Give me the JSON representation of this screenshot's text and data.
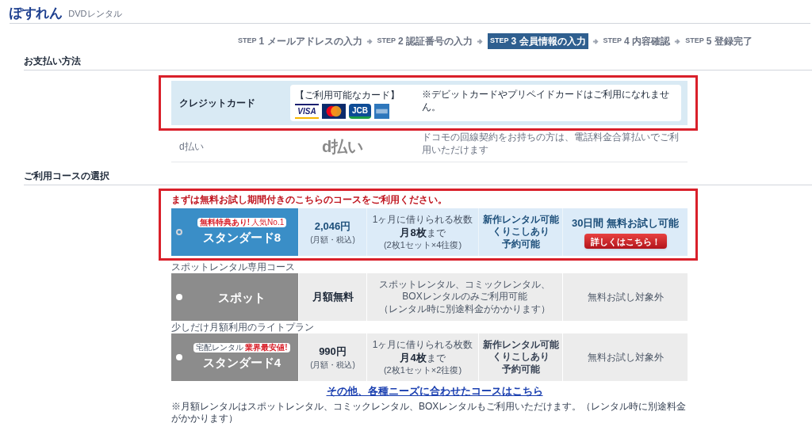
{
  "header": {
    "logo": "ぽすれん",
    "service": "DVDレンタル"
  },
  "steps": [
    {
      "prefix": "STEP",
      "number": "1",
      "label": "メールアドレスの入力",
      "selected": false
    },
    {
      "prefix": "STEP",
      "number": "2",
      "label": "認証番号の入力",
      "selected": false
    },
    {
      "prefix": "STEP",
      "number": "3",
      "label": "会員情報の入力",
      "selected": true
    },
    {
      "prefix": "STEP",
      "number": "4",
      "label": "内容確認",
      "selected": false
    },
    {
      "prefix": "STEP",
      "number": "5",
      "label": "登録完了",
      "selected": false
    }
  ],
  "payment": {
    "heading": "お支払い方法",
    "methods": [
      {
        "kind": "credit",
        "name": "クレジットカード",
        "disabled": false,
        "cards_label": "【ご利用可能なカード】",
        "cards": [
          {
            "kind": "visa",
            "text": "VISA"
          },
          {
            "kind": "mastercard"
          },
          {
            "kind": "jcb",
            "text": "JCB"
          },
          {
            "kind": "amex"
          }
        ],
        "note": "※デビットカードやプリペイドカードはご利用になれません。"
      },
      {
        "kind": "dbarai",
        "name": "d払い",
        "disabled": true,
        "logo": "d払い",
        "note": "ドコモの回線契約をお持ちの方は、電話料金合算払いでご利用いただけます"
      }
    ]
  },
  "course_selection": {
    "heading": "ご利用コースの選択",
    "notice": "まずは無料お試し期間付きのこちらのコースをご利用ください。",
    "courses": [
      {
        "kind": "monthly",
        "selected": true,
        "badge": "無料特典あり!",
        "badge_sub": "人気No.1",
        "name": "スタンダード8",
        "price": "2,046円",
        "price_note": "(月額・税込)",
        "count_label": "1ヶ月に借りられる枚数",
        "count": "月8枚",
        "count_suffix": "まで",
        "count_note": "(2枚1セット×4往復)",
        "features": [
          "新作レンタル可能",
          "くりこしあり",
          "予約可能"
        ],
        "trial": "30日間 無料お試し可能",
        "button": "詳しくはこちら！"
      },
      {
        "kind": "spot",
        "selected": false,
        "caption": "スポットレンタル専用コース",
        "name": "スポット",
        "price": "月額無料",
        "description": "スポットレンタル、コミックレンタル、BOXレンタルのみご利用可能",
        "description_note": "（レンタル時に別途料金がかかります）",
        "trial": "無料お試し対象外"
      },
      {
        "kind": "monthly",
        "selected": false,
        "caption": "少しだけ月額利用のライトプラン",
        "badge_sub": "宅配レンタル",
        "badge": "業界最安値!",
        "name": "スタンダード4",
        "price": "990円",
        "price_note": "(月額・税込)",
        "count_label": "1ヶ月に借りられる枚数",
        "count": "月4枚",
        "count_suffix": "まで",
        "count_note": "(2枚1セット×2往復)",
        "features": [
          "新作レンタル可能",
          "くりこしあり",
          "予約可能"
        ],
        "trial": "無料お試し対象外"
      }
    ],
    "more_link": "その他、各種ニーズに合わせたコースはこちら",
    "footnote": "※月額レンタルはスポットレンタル、コミックレンタル、BOXレンタルもご利用いただけます。（レンタル時に別途料金がかかります）"
  }
}
